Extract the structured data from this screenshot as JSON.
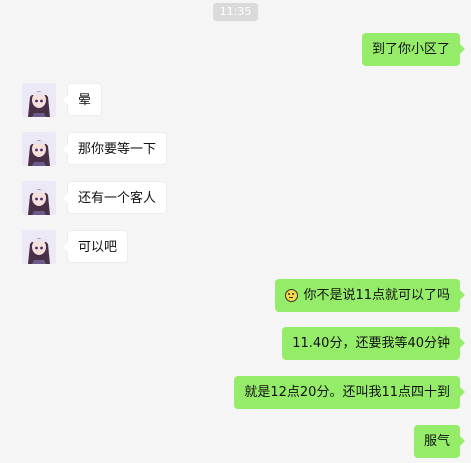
{
  "chat": {
    "timestamp": "11:35",
    "messages": [
      {
        "side": "out",
        "text": "到了你小区了"
      },
      {
        "side": "in",
        "text": "晕"
      },
      {
        "side": "in",
        "text": "那你要等一下"
      },
      {
        "side": "in",
        "text": "还有一个客人"
      },
      {
        "side": "in",
        "text": "可以吧"
      },
      {
        "side": "out",
        "emoji": "annoyed-face-icon",
        "text": "你不是说11点就可以了吗"
      },
      {
        "side": "out",
        "text": "11.40分，还要我等40分钟"
      },
      {
        "side": "out",
        "text": "就是12点20分。还叫我11点四十到"
      },
      {
        "side": "out",
        "text": "服气"
      }
    ]
  },
  "colors": {
    "background": "#f5f5f5",
    "outgoing_bubble": "#95ec69",
    "incoming_bubble": "#ffffff"
  }
}
